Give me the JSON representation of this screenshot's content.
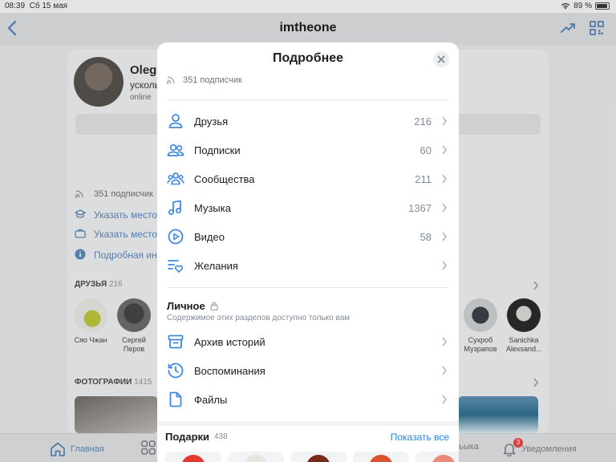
{
  "status_bar": {
    "time": "08:39",
    "date": "Сб 15 мая",
    "battery": "89 %"
  },
  "nav": {
    "title": "imtheone"
  },
  "profile": {
    "name_partial": "Oleg",
    "status_partial": "усколь",
    "online_partial": "online",
    "subscribers": "351 подписчик",
    "set_study": "Указать место",
    "set_work": "Указать место",
    "details_link": "Подробная ин",
    "friends_title": "ДРУЗЬЯ",
    "friends_count": "216",
    "photos_title": "ФОТОГРАФИИ",
    "photos_count": "1415",
    "friends": [
      {
        "name": "Сяо Чжан"
      },
      {
        "name": "Сергей\nПеров"
      },
      {
        "name": "Сухроб\nМузрапов"
      },
      {
        "name": "Sanichka\nAlexsand..."
      }
    ]
  },
  "tabbar": {
    "home": "Главная",
    "partial_right": "ьыка",
    "notifications": "Уведомления",
    "notifications_badge": "3"
  },
  "modal": {
    "title": "Подробнее",
    "subscribers": "351 подписчик",
    "rows": [
      {
        "label": "Друзья",
        "count": "216",
        "icon": "user-icon"
      },
      {
        "label": "Подписки",
        "count": "60",
        "icon": "users-icon"
      },
      {
        "label": "Сообщества",
        "count": "211",
        "icon": "communities-icon"
      },
      {
        "label": "Музыка",
        "count": "1367",
        "icon": "music-icon"
      },
      {
        "label": "Видео",
        "count": "58",
        "icon": "video-icon"
      },
      {
        "label": "Желания",
        "count": "",
        "icon": "wishlist-icon"
      }
    ],
    "personal": {
      "title": "Личное",
      "subtitle": "Содержимое этих разделов доступно только вам",
      "rows": [
        {
          "label": "Архив историй",
          "icon": "archive-icon"
        },
        {
          "label": "Воспоминания",
          "icon": "memories-icon"
        },
        {
          "label": "Файлы",
          "icon": "file-icon"
        }
      ]
    },
    "gifts": {
      "title": "Подарки",
      "count": "438",
      "show_all": "Показать все"
    }
  },
  "colors": {
    "accent": "#2d81e0",
    "icon": "#3f8ae0",
    "secondary": "#818c99"
  }
}
